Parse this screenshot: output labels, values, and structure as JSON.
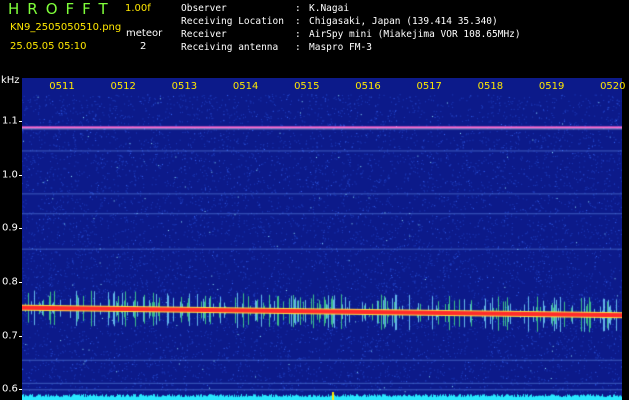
{
  "header": {
    "app_title": "HROFFT",
    "version": "1.00f",
    "file_name": "KN9_2505050510.png",
    "timestamp": "25.05.05 05:10",
    "mode_label": "meteor",
    "mode_value": "2"
  },
  "info": [
    {
      "label": "Observer",
      "sep": ":",
      "value": "K.Nagai"
    },
    {
      "label": "Receiving Location",
      "sep": ":",
      "value": "Chigasaki, Japan (139.414 35.340)"
    },
    {
      "label": "Receiver",
      "sep": ":",
      "value": "AirSpy mini (Miakejima VOR 108.65MHz)"
    },
    {
      "label": "Receiving antenna",
      "sep": ":",
      "value": "Maspro FM-3"
    }
  ],
  "spectrogram": {
    "unit": "kHz",
    "time_labels": [
      "0511",
      "0512",
      "0513",
      "0514",
      "0515",
      "0516",
      "0517",
      "0518",
      "0519",
      "0520"
    ],
    "freq_labels": [
      "1.1",
      "1.0",
      "0.9",
      "0.8",
      "0.7",
      "0.6"
    ],
    "freq_range_khz": [
      0.58,
      1.18
    ],
    "carrier_khz": 1.088,
    "echo_band_khz": [
      0.752,
      0.738
    ],
    "colors": {
      "background": "#0c1a8a",
      "noise": "#3a6cff",
      "carrier": "#ff6ad0",
      "echo_core": "#ff2a2a",
      "echo_fringe": "#ffe14a",
      "bottom_band": "#29e8ff",
      "time_label": "#ffe800"
    }
  }
}
